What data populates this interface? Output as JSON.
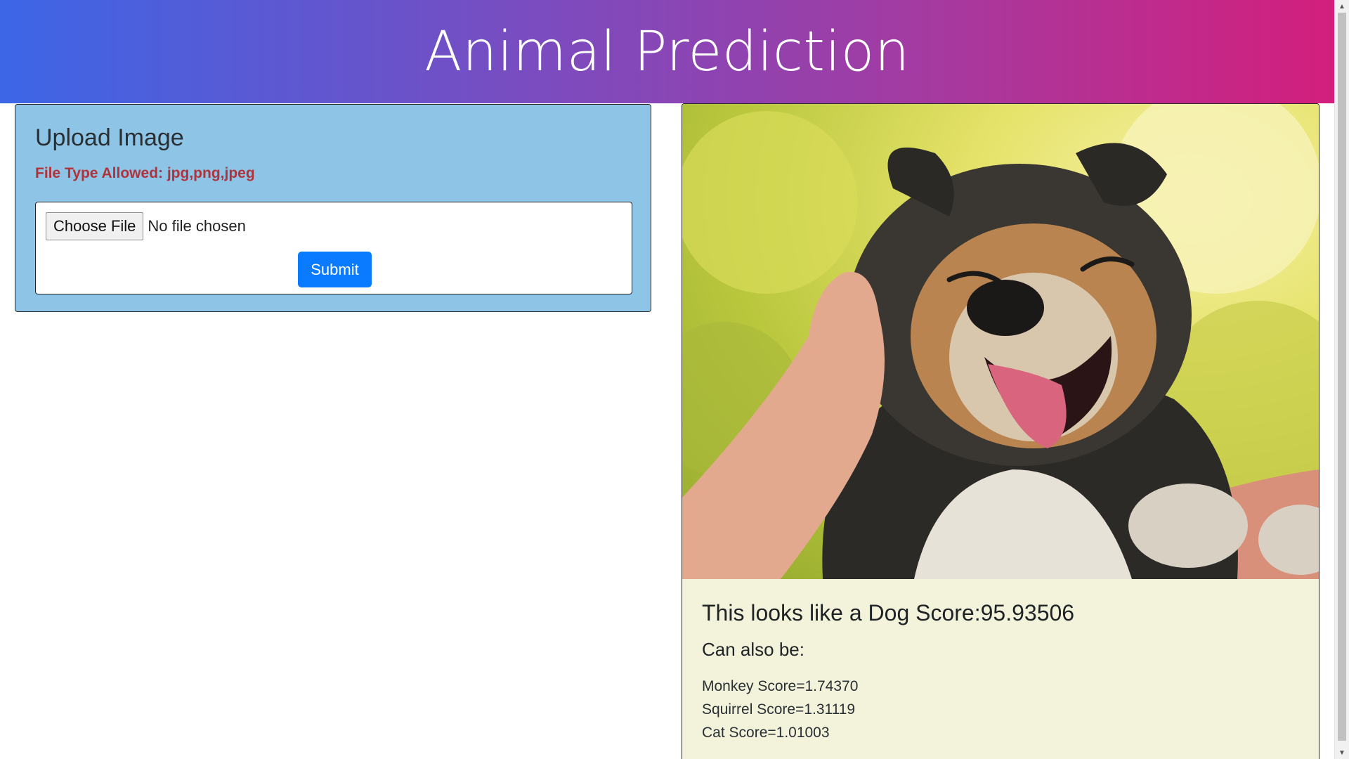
{
  "header": {
    "title": "Animal Prediction"
  },
  "upload": {
    "heading": "Upload Image",
    "allowed_types": "File Type Allowed: jpg,png,jpeg",
    "choose_label": "Choose File",
    "file_status": "No file chosen",
    "submit_label": "Submit"
  },
  "result": {
    "image_subject": "dog photo",
    "prediction": "This looks like a Dog Score:95.93506",
    "also_heading": "Can also be:",
    "alternatives": [
      "Monkey Score=1.74370",
      "Squirrel Score=1.31119",
      "Cat Score=1.01003"
    ]
  },
  "colors": {
    "banner_start": "#3c66e6",
    "banner_end": "#d31f7c",
    "upload_card_bg": "#8ec5e6",
    "allowed_text": "#b0323b",
    "submit_bg": "#0a7bff",
    "result_card_bg": "#f3f3dc"
  },
  "icons": {
    "scroll_up": "scroll-up-arrow-icon",
    "scroll_down": "scroll-down-arrow-icon"
  }
}
